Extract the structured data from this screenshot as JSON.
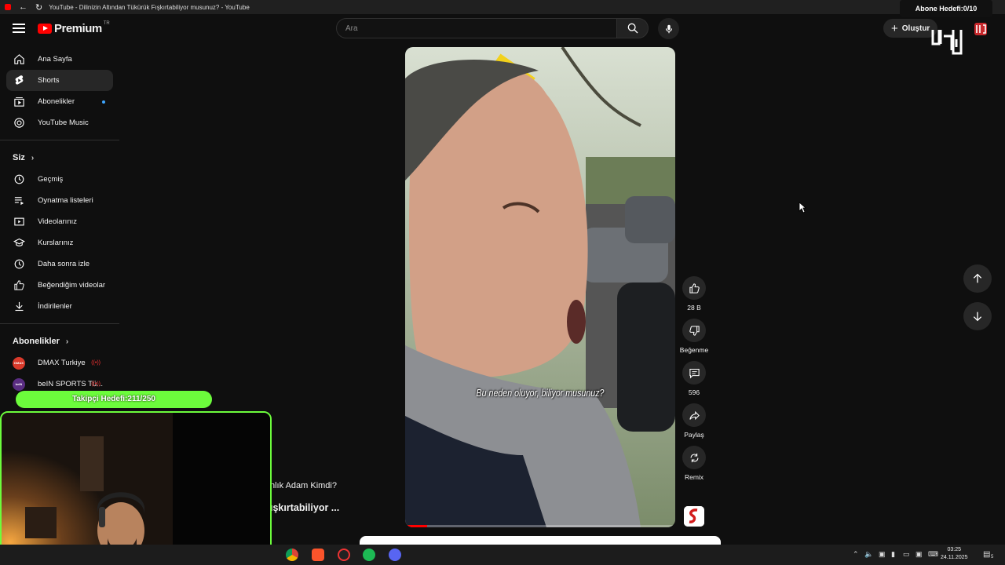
{
  "browser": {
    "tab_title": "YouTube - Dilinizin Altından Tükürük Fışkırtabiliyor musunuz? - YouTube"
  },
  "header": {
    "brand": "Premium",
    "country": "TR",
    "search_placeholder": "Ara",
    "create_label": "Oluştur"
  },
  "stream_overlay": {
    "subscriber_goal": "Abone Hedefi:0/10",
    "follower_goal": "Takipçi Hedefi:211/250"
  },
  "sidebar": {
    "main": [
      {
        "label": "Ana Sayfa",
        "icon": "home-icon"
      },
      {
        "label": "Shorts",
        "icon": "shorts-icon",
        "active": true
      },
      {
        "label": "Abonelikler",
        "icon": "subscriptions-icon"
      },
      {
        "label": "YouTube Music",
        "icon": "music-icon"
      }
    ],
    "you_header": "Siz",
    "you": [
      {
        "label": "Geçmiş",
        "icon": "history-icon"
      },
      {
        "label": "Oynatma listeleri",
        "icon": "playlist-icon"
      },
      {
        "label": "Videolarınız",
        "icon": "videos-icon"
      },
      {
        "label": "Kurslarınız",
        "icon": "courses-icon"
      },
      {
        "label": "Daha sonra izle",
        "icon": "watch-later-icon"
      },
      {
        "label": "Beğendiğim videolar",
        "icon": "liked-icon"
      },
      {
        "label": "İndirilenler",
        "icon": "download-icon"
      }
    ],
    "subs_header": "Abonelikler",
    "subs": [
      {
        "label": "DMAX Turkiye",
        "avatar_text": "DMAX",
        "color": "#d93a2b"
      },
      {
        "label": "beIN SPORTS Tü...",
        "avatar_text": "beIN",
        "color": "#5a2d82"
      }
    ]
  },
  "short": {
    "subtitle": "Bu neden oluyor, biliyor musunuz?",
    "progress": 0.08,
    "likes": "28 B",
    "dislike_label": "Beğenme",
    "comments": "596",
    "share_label": "Paylaş",
    "remix_label": "Remix"
  },
  "background_text": {
    "line1": "nlık Adam Kimdi?",
    "line2": "ışkırtabiliyor ..."
  },
  "taskbar": {
    "time": "03:25",
    "date": "24.11.2025",
    "notifications": "5"
  }
}
